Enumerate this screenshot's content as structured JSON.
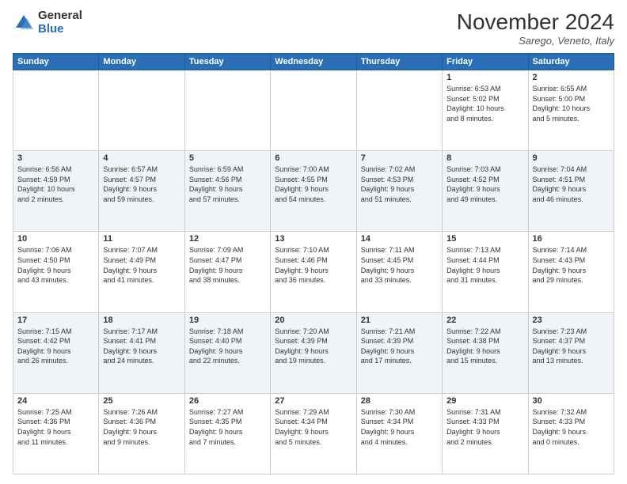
{
  "header": {
    "logo_general": "General",
    "logo_blue": "Blue",
    "month_title": "November 2024",
    "location": "Sarego, Veneto, Italy"
  },
  "columns": [
    "Sunday",
    "Monday",
    "Tuesday",
    "Wednesday",
    "Thursday",
    "Friday",
    "Saturday"
  ],
  "weeks": [
    [
      {
        "day": "",
        "info": ""
      },
      {
        "day": "",
        "info": ""
      },
      {
        "day": "",
        "info": ""
      },
      {
        "day": "",
        "info": ""
      },
      {
        "day": "",
        "info": ""
      },
      {
        "day": "1",
        "info": "Sunrise: 6:53 AM\nSunset: 5:02 PM\nDaylight: 10 hours\nand 8 minutes."
      },
      {
        "day": "2",
        "info": "Sunrise: 6:55 AM\nSunset: 5:00 PM\nDaylight: 10 hours\nand 5 minutes."
      }
    ],
    [
      {
        "day": "3",
        "info": "Sunrise: 6:56 AM\nSunset: 4:59 PM\nDaylight: 10 hours\nand 2 minutes."
      },
      {
        "day": "4",
        "info": "Sunrise: 6:57 AM\nSunset: 4:57 PM\nDaylight: 9 hours\nand 59 minutes."
      },
      {
        "day": "5",
        "info": "Sunrise: 6:59 AM\nSunset: 4:56 PM\nDaylight: 9 hours\nand 57 minutes."
      },
      {
        "day": "6",
        "info": "Sunrise: 7:00 AM\nSunset: 4:55 PM\nDaylight: 9 hours\nand 54 minutes."
      },
      {
        "day": "7",
        "info": "Sunrise: 7:02 AM\nSunset: 4:53 PM\nDaylight: 9 hours\nand 51 minutes."
      },
      {
        "day": "8",
        "info": "Sunrise: 7:03 AM\nSunset: 4:52 PM\nDaylight: 9 hours\nand 49 minutes."
      },
      {
        "day": "9",
        "info": "Sunrise: 7:04 AM\nSunset: 4:51 PM\nDaylight: 9 hours\nand 46 minutes."
      }
    ],
    [
      {
        "day": "10",
        "info": "Sunrise: 7:06 AM\nSunset: 4:50 PM\nDaylight: 9 hours\nand 43 minutes."
      },
      {
        "day": "11",
        "info": "Sunrise: 7:07 AM\nSunset: 4:49 PM\nDaylight: 9 hours\nand 41 minutes."
      },
      {
        "day": "12",
        "info": "Sunrise: 7:09 AM\nSunset: 4:47 PM\nDaylight: 9 hours\nand 38 minutes."
      },
      {
        "day": "13",
        "info": "Sunrise: 7:10 AM\nSunset: 4:46 PM\nDaylight: 9 hours\nand 36 minutes."
      },
      {
        "day": "14",
        "info": "Sunrise: 7:11 AM\nSunset: 4:45 PM\nDaylight: 9 hours\nand 33 minutes."
      },
      {
        "day": "15",
        "info": "Sunrise: 7:13 AM\nSunset: 4:44 PM\nDaylight: 9 hours\nand 31 minutes."
      },
      {
        "day": "16",
        "info": "Sunrise: 7:14 AM\nSunset: 4:43 PM\nDaylight: 9 hours\nand 29 minutes."
      }
    ],
    [
      {
        "day": "17",
        "info": "Sunrise: 7:15 AM\nSunset: 4:42 PM\nDaylight: 9 hours\nand 26 minutes."
      },
      {
        "day": "18",
        "info": "Sunrise: 7:17 AM\nSunset: 4:41 PM\nDaylight: 9 hours\nand 24 minutes."
      },
      {
        "day": "19",
        "info": "Sunrise: 7:18 AM\nSunset: 4:40 PM\nDaylight: 9 hours\nand 22 minutes."
      },
      {
        "day": "20",
        "info": "Sunrise: 7:20 AM\nSunset: 4:39 PM\nDaylight: 9 hours\nand 19 minutes."
      },
      {
        "day": "21",
        "info": "Sunrise: 7:21 AM\nSunset: 4:39 PM\nDaylight: 9 hours\nand 17 minutes."
      },
      {
        "day": "22",
        "info": "Sunrise: 7:22 AM\nSunset: 4:38 PM\nDaylight: 9 hours\nand 15 minutes."
      },
      {
        "day": "23",
        "info": "Sunrise: 7:23 AM\nSunset: 4:37 PM\nDaylight: 9 hours\nand 13 minutes."
      }
    ],
    [
      {
        "day": "24",
        "info": "Sunrise: 7:25 AM\nSunset: 4:36 PM\nDaylight: 9 hours\nand 11 minutes."
      },
      {
        "day": "25",
        "info": "Sunrise: 7:26 AM\nSunset: 4:36 PM\nDaylight: 9 hours\nand 9 minutes."
      },
      {
        "day": "26",
        "info": "Sunrise: 7:27 AM\nSunset: 4:35 PM\nDaylight: 9 hours\nand 7 minutes."
      },
      {
        "day": "27",
        "info": "Sunrise: 7:29 AM\nSunset: 4:34 PM\nDaylight: 9 hours\nand 5 minutes."
      },
      {
        "day": "28",
        "info": "Sunrise: 7:30 AM\nSunset: 4:34 PM\nDaylight: 9 hours\nand 4 minutes."
      },
      {
        "day": "29",
        "info": "Sunrise: 7:31 AM\nSunset: 4:33 PM\nDaylight: 9 hours\nand 2 minutes."
      },
      {
        "day": "30",
        "info": "Sunrise: 7:32 AM\nSunset: 4:33 PM\nDaylight: 9 hours\nand 0 minutes."
      }
    ]
  ]
}
